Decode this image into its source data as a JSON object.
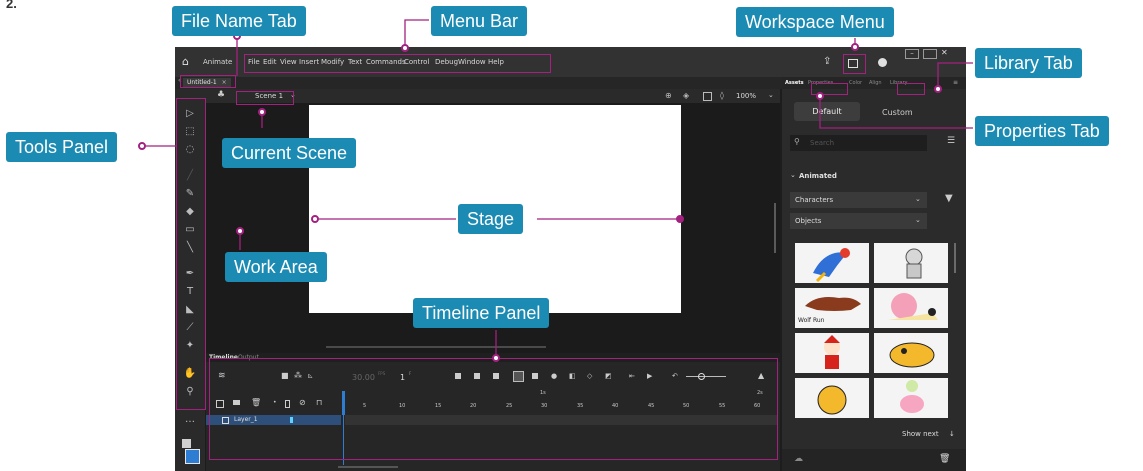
{
  "figure_label": "2.",
  "callouts": {
    "file_name_tab": "File Name Tab",
    "menu_bar": "Menu Bar",
    "workspace_menu": "Workspace Menu",
    "library_tab": "Library Tab",
    "properties_tab": "Properties Tab",
    "tools_panel": "Tools Panel",
    "current_scene": "Current Scene",
    "stage": "Stage",
    "work_area": "Work Area",
    "timeline_panel": "Timeline Panel"
  },
  "app": {
    "name": "Animate",
    "menus": [
      "File",
      "Edit",
      "View",
      "Insert",
      "Modify",
      "Text",
      "Commands",
      "Control",
      "Debug",
      "Window",
      "Help"
    ],
    "document_tab": "Untitled-1",
    "scene": "Scene 1",
    "zoom": "100%"
  },
  "right_panel": {
    "tabs": [
      "Assets",
      "Properties",
      "Color",
      "Align",
      "Library"
    ],
    "toggle": [
      "Default",
      "Custom"
    ],
    "search_placeholder": "Search",
    "section": "Animated",
    "dropdowns": [
      "Characters",
      "Objects"
    ],
    "asset_caption": "Wolf Run",
    "show_next": "Show next"
  },
  "timeline": {
    "tabs": [
      "Timeline",
      "Output"
    ],
    "fps": "30.00",
    "fps_unit": "FPS",
    "frame": "1",
    "frame_unit": "F",
    "ruler": [
      "5",
      "10",
      "15",
      "20",
      "25",
      "30",
      "35",
      "40",
      "45",
      "50",
      "55",
      "60"
    ],
    "ruler_seconds": [
      "1s",
      "2s"
    ],
    "layer": "Layer_1"
  },
  "colors": {
    "callout": "#1b8bb3",
    "highlight": "#a3217f",
    "accent": "#2d7dd2"
  }
}
